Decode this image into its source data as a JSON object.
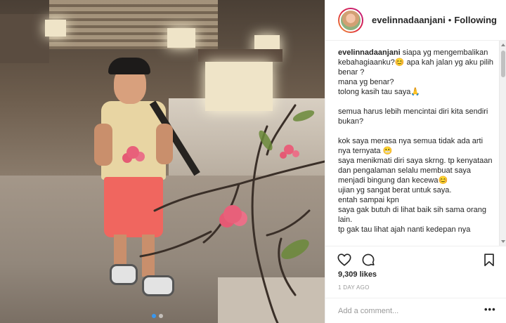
{
  "post": {
    "username": "evelinnadaanjani",
    "separator": "•",
    "follow_status": "Following",
    "caption_username": "evelinnadaanjani",
    "caption_text": " siapa yg mengembalikan kebahagiaanku?😊 apa kah jalan yg aku pilih benar ?\nmana yg benar?\ntolong kasih tau saya🙏\n\nsemua harus lebih mencintai diri kita sendiri bukan?\n\nkok saya merasa nya semua tidak ada arti nya ternyata 😬\nsaya menikmati diri saya skrng. tp kenyataan dan pengalaman selalu membuat saya menjadi bingung dan kecewa😊\nujian yg sangat berat untuk saya.\nentah sampai kpn\nsaya gak butuh di lihat baik sih sama orang lain.\ntp gak tau lihat ajah nanti kedepan nya",
    "likes": "9,309 likes",
    "time": "1 day ago",
    "comment_placeholder": "Add a comment...",
    "more_label": "•••"
  },
  "icons": {
    "like": "heart-icon",
    "comment": "comment-icon",
    "save": "bookmark-icon",
    "more": "ellipsis-icon"
  },
  "carousel": {
    "total": 2,
    "active": 1
  },
  "colors": {
    "accent": "#3897f0",
    "text": "#262626",
    "muted": "#999999",
    "border": "#efefef"
  }
}
